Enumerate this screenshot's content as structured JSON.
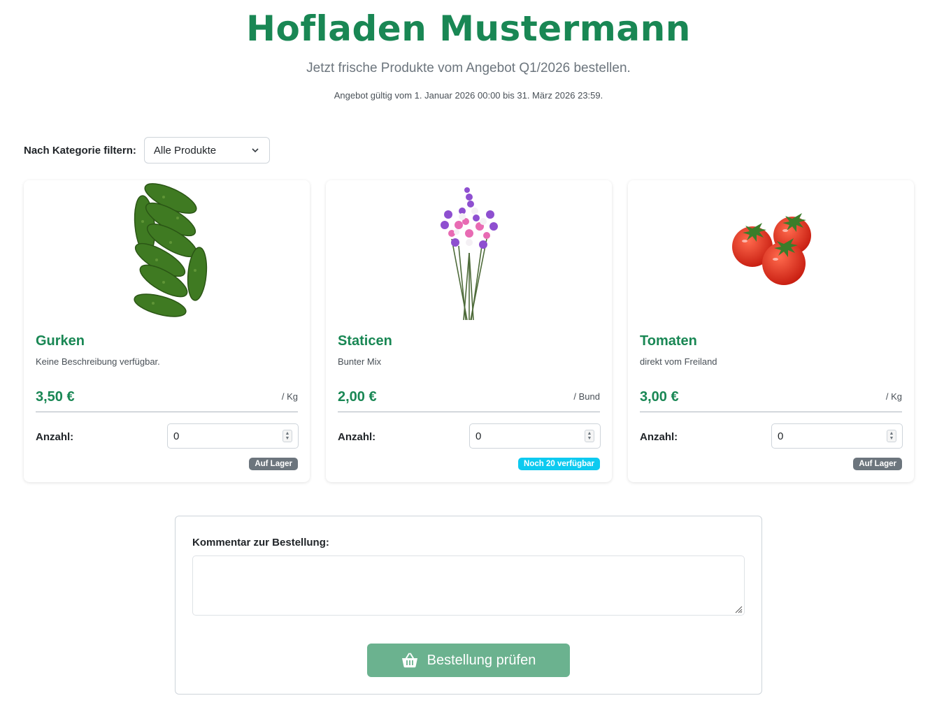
{
  "header": {
    "title": "Hofladen Mustermann",
    "subtitle": "Jetzt frische Produkte vom Angebot Q1/2026 bestellen.",
    "validity": "Angebot gültig vom 1. Januar 2026 00:00 bis 31. März 2026 23:59."
  },
  "filter": {
    "label": "Nach Kategorie filtern:",
    "selected": "Alle Produkte"
  },
  "products": [
    {
      "name": "Gurken",
      "description": "Keine Beschreibung verfügbar.",
      "price": "3,50 €",
      "unit": "/ Kg",
      "qty_label": "Anzahl:",
      "qty": "0",
      "badge": "Auf Lager",
      "badge_color": "#6c757d"
    },
    {
      "name": "Staticen",
      "description": "Bunter Mix",
      "price": "2,00 €",
      "unit": "/ Bund",
      "qty_label": "Anzahl:",
      "qty": "0",
      "badge": "Noch 20 verfügbar",
      "badge_color": "#0dcaf0"
    },
    {
      "name": "Tomaten",
      "description": "direkt vom Freiland",
      "price": "3,00 €",
      "unit": "/ Kg",
      "qty_label": "Anzahl:",
      "qty": "0",
      "badge": "Auf Lager",
      "badge_color": "#6c757d"
    }
  ],
  "order": {
    "comment_label": "Kommentar zur Bestellung:",
    "comment_value": "",
    "submit_label": "Bestellung prüfen",
    "submit_icon": "basket-icon"
  },
  "colors": {
    "accent": "#198754",
    "button": "#6bb28f"
  }
}
